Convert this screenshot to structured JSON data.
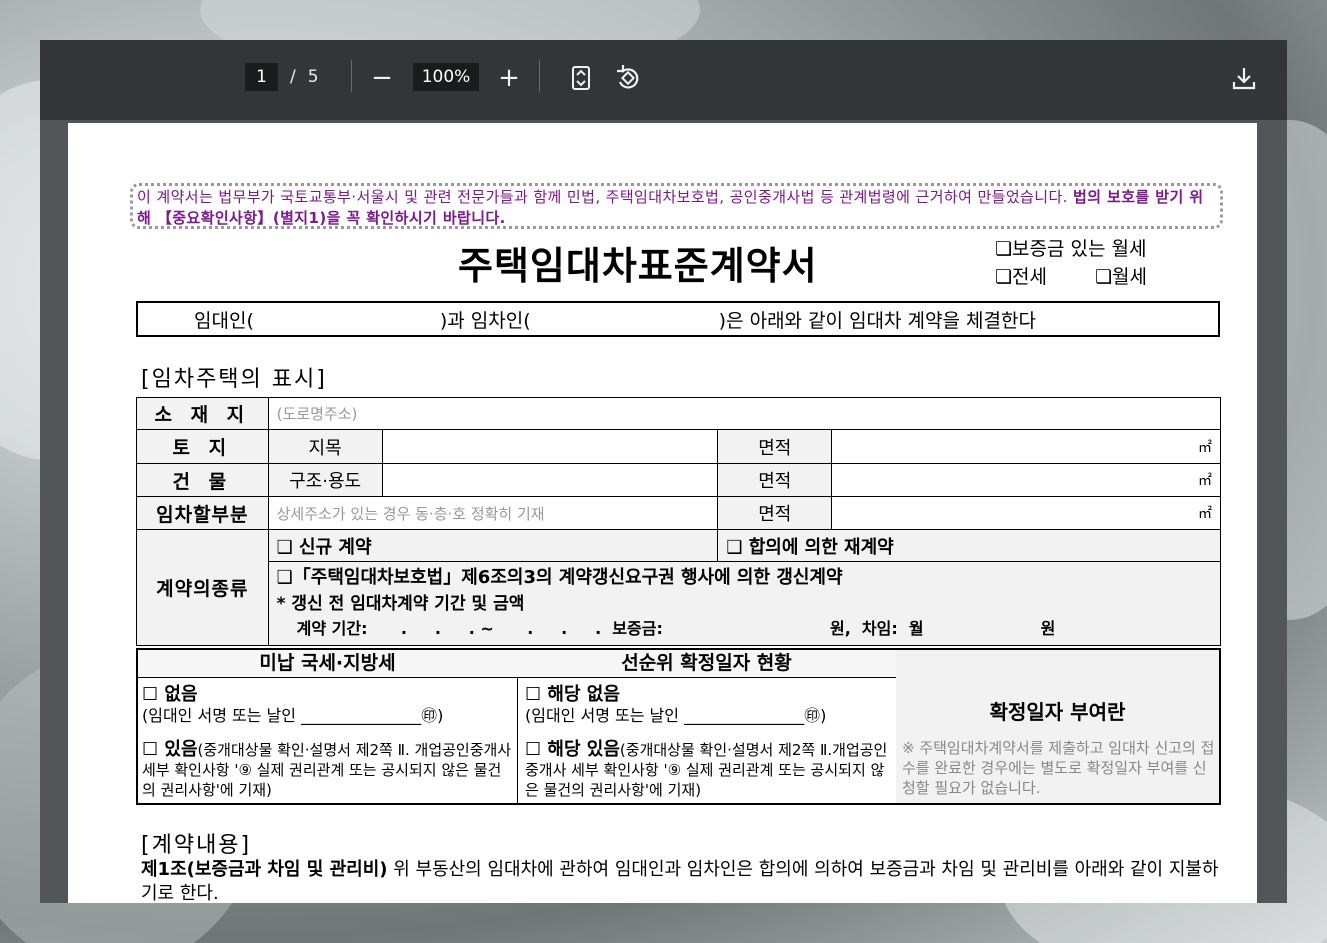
{
  "toolbar": {
    "current_page": "1",
    "page_separator": "/",
    "total_pages": "5",
    "zoom_out": "−",
    "zoom_level": "100%",
    "zoom_in": "+"
  },
  "notice": {
    "text": "이 계약서는 법무부가 국토교통부·서울시 및 관련 전문가들과 함께 민법, 주택임대차보호법, 공인중개사법 등 관계법령에 근거하여 만들었습니다. ",
    "bold": "법의 보호를 받기 위해 【중요확인사항】(별지1)을 꼭 확인하시기 바랍니다."
  },
  "title": "주택임대차표준계약서",
  "contract_types": {
    "line1": "❏보증금 있는 월세",
    "jeonse": "❏전세",
    "monthly": "❏월세"
  },
  "parties": {
    "landlord": "임대인(",
    "tenant": ")과 임차인(",
    "tail": ")은 아래와 같이 임대차 계약을 체결한다"
  },
  "section1": "[임차주택의 표시]",
  "table": {
    "location_label": "소 재 지",
    "location_placeholder": "(도로명주소)",
    "land_label": "토   지",
    "land_category": "지목",
    "area_label": "면적",
    "unit": "㎡",
    "building_label": "건   물",
    "structure_label": "구조·용도",
    "rental_part_label": "임차할부분",
    "rental_part_placeholder": "상세주소가 있는 경우 동·층·호 정확히 기재",
    "contract_kind_label": "계약의종류",
    "new_contract": "❑ 신규 계약",
    "renewal_agreement": "❑ 합의에 의한 재계약",
    "renewal_right": "❑「주택임대차보호법」제6조의3의 계약갱신요구권 행사에 의한 갱신계약",
    "renewal_note": "* 갱신 전 임대차계약 기간 및 금액",
    "period_line": "계약 기간:      .     .     . ~      .     .     .  보증금:                              원,  차임:  월                     원"
  },
  "tax": {
    "unpaid_header": "미납 국세·지방세",
    "priority_header": "선순위 확정일자 현황",
    "none": "☐ 없음",
    "none_sign": "(임대인 서명 또는 날인 _______________㊞)",
    "exists": "☐ 있음",
    "exists_note": "(중개대상물 확인·설명서 제2쪽 Ⅱ. 개업공인중개사 세부 확인사항 '⑨ 실제 권리관계 또는 공시되지 않은 물건의 권리사항'에 기재)",
    "p_none": "☐ 해당 없음",
    "p_none_sign": "(임대인 서명 또는 날인 _______________㊞)",
    "p_exists": "☐ 해당 있음",
    "p_exists_note": "(중개대상물 확인·설명서 제2쪽 Ⅱ.개업공인중개사 세부 확인사항 '⑨ 실제 권리관계 또는 공시되지 않은 물건의 권리사항'에 기재)",
    "fixed_date_title": "확정일자 부여란",
    "fixed_date_note": "※ 주택임대차계약서를 제출하고 임대차 신고의 접수를 완료한 경우에는 별도로 확정일자 부여를 신청할 필요가 없습니다."
  },
  "section2": "[계약내용]",
  "clause1": {
    "heading": "제1조(보증금과 차임 및 관리비)",
    "text": " 위 부동산의 임대차에 관하여 임대인과 임차인은 합의에 의하여 보증금과 차임 및 관리비를 아래와 같이 지불하기로 한다."
  }
}
